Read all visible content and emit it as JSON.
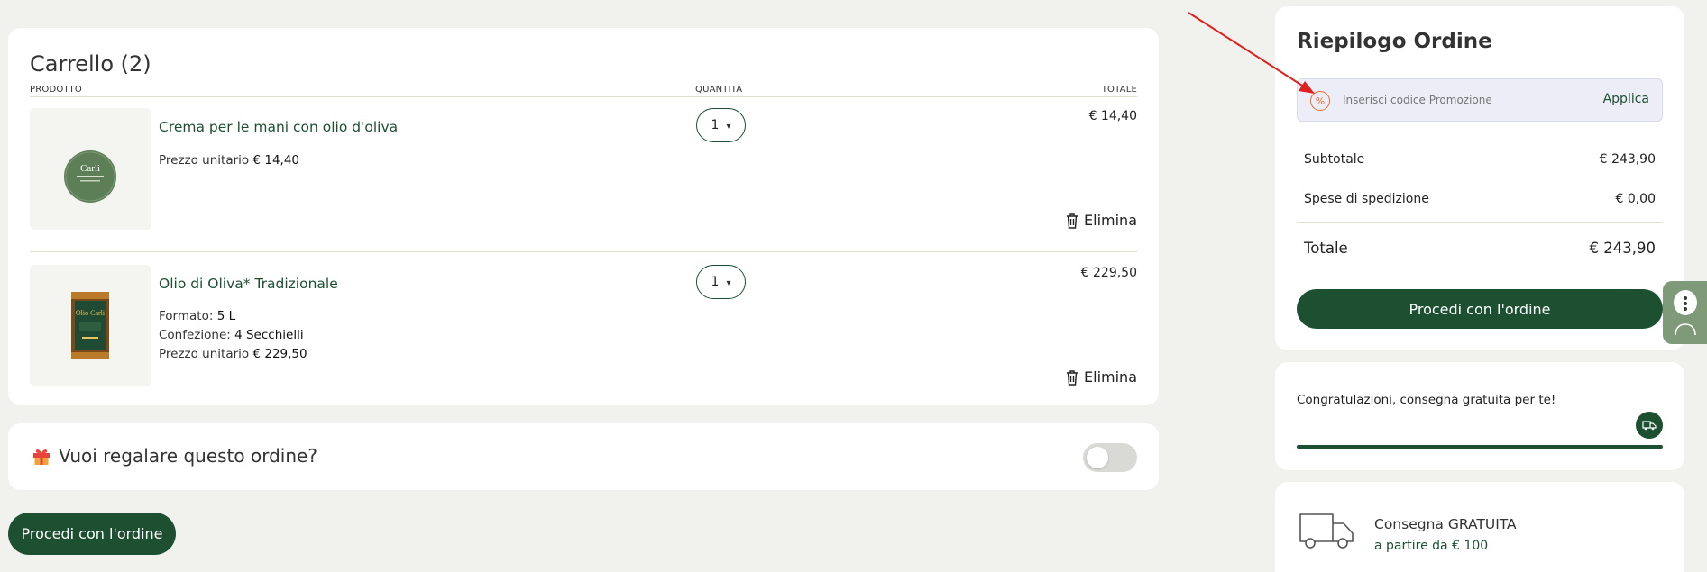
{
  "cart": {
    "title": "Carrello (2)",
    "headers": {
      "product": "PRODOTTO",
      "quantity": "QUANTITÀ",
      "total": "TOTALE"
    },
    "items": [
      {
        "name": "Crema per le mani con olio d'oliva",
        "details": [
          {
            "label": "Prezzo unitario",
            "value": "€ 14,40"
          }
        ],
        "quantity": "1",
        "total": "€ 14,40",
        "remove_label": "Elimina"
      },
      {
        "name": "Olio di Oliva* Tradizionale",
        "details": [
          {
            "label": "Formato:",
            "value": "5 L"
          },
          {
            "label": "Confezione:",
            "value": "4 Secchielli"
          },
          {
            "label": "Prezzo unitario",
            "value": "€ 229,50"
          }
        ],
        "quantity": "1",
        "total": "€ 229,50",
        "remove_label": "Elimina"
      }
    ]
  },
  "gift": {
    "label": "Vuoi regalare questo ordine?",
    "icon": "gift-icon",
    "enabled": false
  },
  "checkout_bottom_label": "Procedi con l'ordine",
  "summary": {
    "title": "Riepilogo Ordine",
    "promo": {
      "placeholder": "Inserisci codice Promozione",
      "apply_label": "Applica"
    },
    "subtotal_label": "Subtotale",
    "subtotal_value": "€ 243,90",
    "shipping_label": "Spese di spedizione",
    "shipping_value": "€ 0,00",
    "total_label": "Totale",
    "total_value": "€ 243,90",
    "checkout_label": "Procedi con l'ordine"
  },
  "free_shipping": {
    "message": "Congratulazioni, consegna gratuita per te!",
    "progress": 1.0
  },
  "delivery": {
    "title": "Consegna GRATUITA",
    "subtitle": "a partire da € 100"
  },
  "colors": {
    "brand_green": "#1d5030",
    "background": "#f1f1ed",
    "promo_accent": "#e96b2d",
    "annotation_arrow": "#e02020"
  }
}
